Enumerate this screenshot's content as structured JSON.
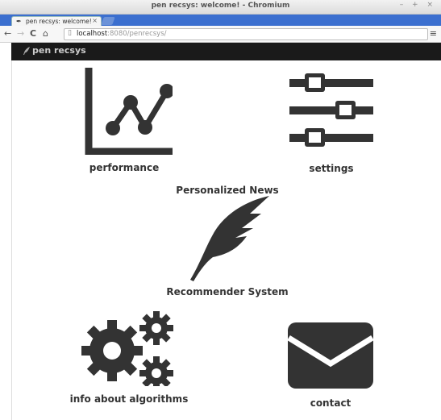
{
  "window": {
    "title": "pen recsys: welcome! - Chromium",
    "controls": "– + ×"
  },
  "tab": {
    "label": "pen recsys: welcome!",
    "close": "×"
  },
  "toolbar": {
    "back": "←",
    "forward": "→",
    "reload": "C",
    "home": "⌂",
    "url_host": "localhost",
    "url_rest": ":8080/penrecsys/",
    "menu": "≡"
  },
  "navbar": {
    "brand": "pen recsys"
  },
  "tiles": {
    "performance": "performance",
    "settings": "settings",
    "algorithms": "info about algorithms",
    "contact": "contact"
  },
  "hero": {
    "top_label": "Personalized News",
    "bottom_label": "Recommender System"
  },
  "colors": {
    "icon": "#333333",
    "navbar": "#1a1a1a",
    "tabstrip": "#3b6fcf"
  },
  "icons": [
    "line-chart-icon",
    "sliders-icon",
    "feather-icon",
    "gears-icon",
    "envelope-icon"
  ]
}
